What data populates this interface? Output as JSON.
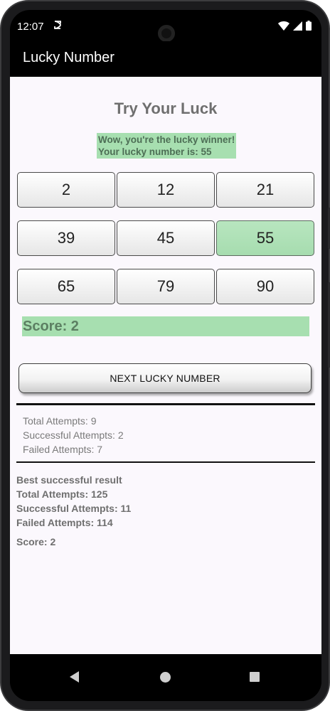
{
  "status_bar": {
    "time": "12:07",
    "icons": [
      "sync-icon",
      "wifi-icon",
      "signal-icon",
      "battery-icon"
    ]
  },
  "app_bar": {
    "title": "Lucky Number"
  },
  "main": {
    "heading": "Try Your Luck",
    "message": {
      "line1": "Wow, you're the lucky winner!",
      "line2": "Your lucky number is: 55"
    },
    "numbers": [
      "2",
      "12",
      "21",
      "39",
      "45",
      "55",
      "65",
      "79",
      "90"
    ],
    "selected_number": "55",
    "score": "Score: 2",
    "next_button": "NEXT LUCKY NUMBER",
    "stats": {
      "total": "Total Attempts: 9",
      "successful": "Successful Attempts: 2",
      "failed": "Failed Attempts:  7"
    },
    "best": {
      "title": "Best successful result",
      "total": "Total Attempts: 125",
      "successful": "Successful Attempts: 11",
      "failed": "Failed Attempts:  114",
      "score": "Score: 2"
    }
  },
  "colors": {
    "highlight": "#a7dfb0",
    "highlight_text": "#5c7f62",
    "appbar": "#000000",
    "background": "#fbf8fd"
  }
}
